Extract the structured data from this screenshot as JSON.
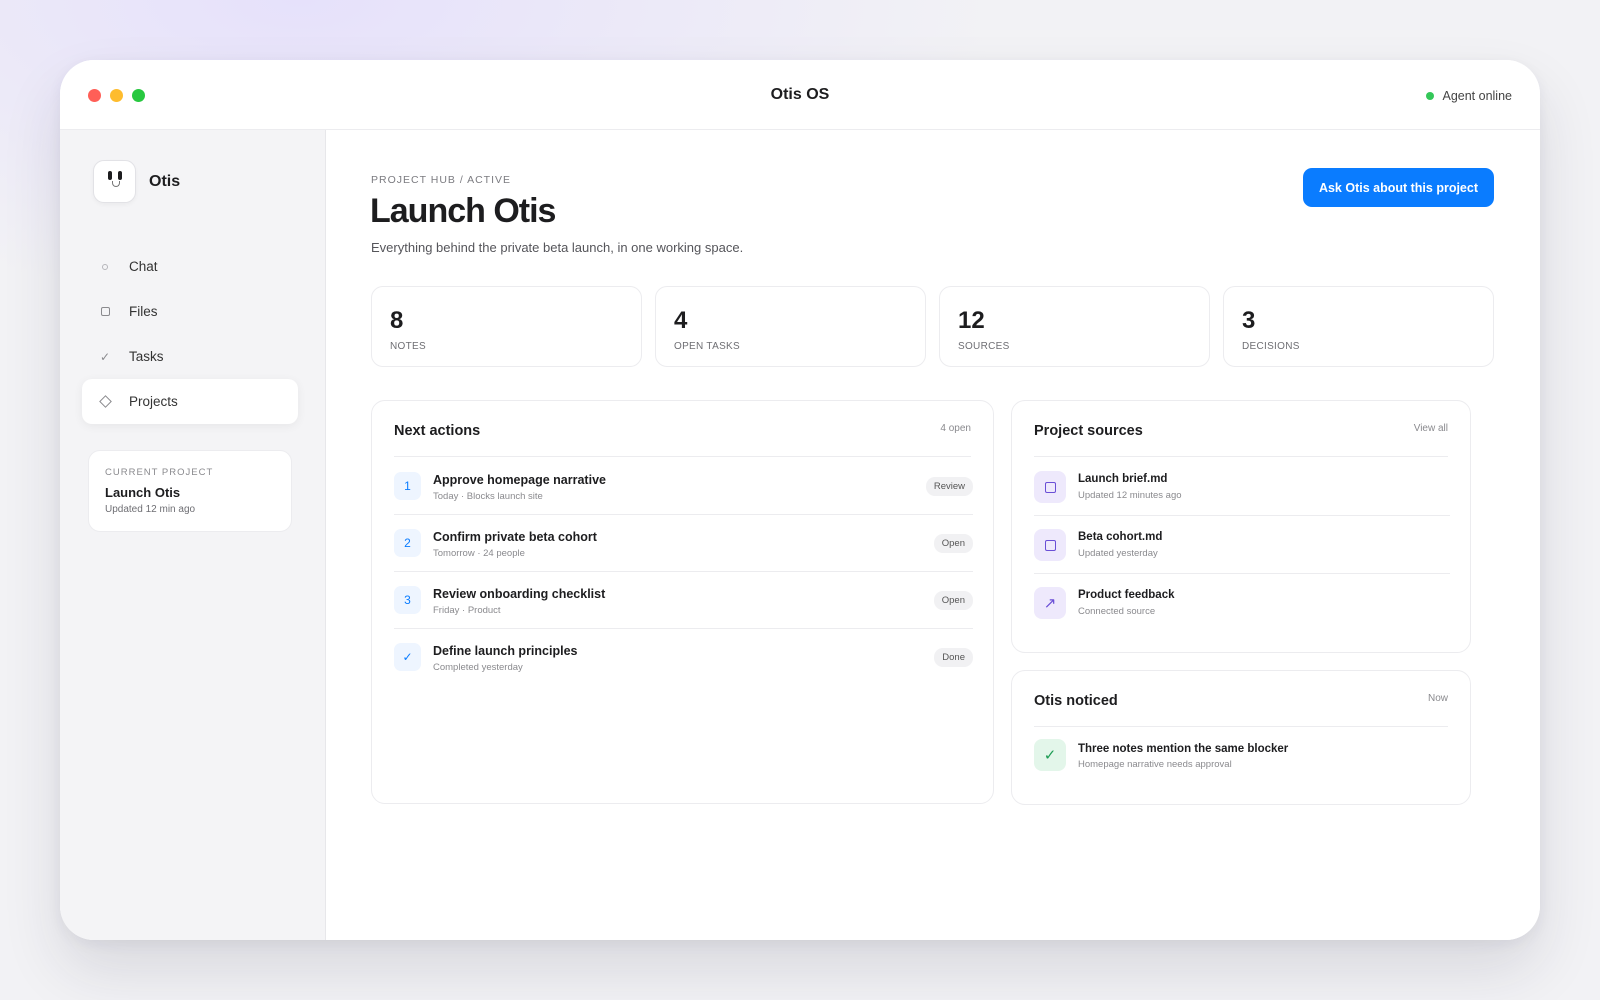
{
  "window": {
    "title": "Otis OS",
    "status": "Agent online"
  },
  "sidebar": {
    "brand": "Otis",
    "items": [
      {
        "label": "Chat",
        "icon": "chat-circle-icon"
      },
      {
        "label": "Files",
        "icon": "file-square-icon"
      },
      {
        "label": "Tasks",
        "icon": "check-icon"
      },
      {
        "label": "Projects",
        "icon": "diamond-icon",
        "active": true
      }
    ],
    "current_project": {
      "label": "Current project",
      "name": "Launch Otis",
      "updated": "Updated 12 min ago"
    }
  },
  "main": {
    "breadcrumb": "Project hub / Active",
    "title": "Launch Otis",
    "subtitle": "Everything behind the private beta launch, in one working space.",
    "ask_button": "Ask Otis about this project",
    "stats": [
      {
        "value": "8",
        "label": "Notes"
      },
      {
        "value": "4",
        "label": "Open tasks"
      },
      {
        "value": "12",
        "label": "Sources"
      },
      {
        "value": "3",
        "label": "Decisions"
      }
    ],
    "next_actions": {
      "title": "Next actions",
      "meta": "4 open",
      "items": [
        {
          "marker": "1",
          "title": "Approve homepage narrative",
          "sub": "Today · Blocks launch site",
          "badge": "Review"
        },
        {
          "marker": "2",
          "title": "Confirm private beta cohort",
          "sub": "Tomorrow · 24 people",
          "badge": "Open"
        },
        {
          "marker": "3",
          "title": "Review onboarding checklist",
          "sub": "Friday · Product",
          "badge": "Open"
        },
        {
          "marker": "✓",
          "title": "Define launch principles",
          "sub": "Completed yesterday",
          "badge": "Done"
        }
      ]
    },
    "sources": {
      "title": "Project sources",
      "meta": "View all",
      "items": [
        {
          "title": "Launch brief.md",
          "sub": "Updated 12 minutes ago",
          "icon": "file-icon"
        },
        {
          "title": "Beta cohort.md",
          "sub": "Updated yesterday",
          "icon": "file-icon"
        },
        {
          "title": "Product feedback",
          "sub": "Connected source",
          "icon": "arrow-up-right-icon"
        }
      ]
    },
    "noticed": {
      "title": "Otis noticed",
      "meta": "Now",
      "item": {
        "title": "Three notes mention the same blocker",
        "sub": "Homepage narrative needs approval",
        "icon": "check-icon"
      }
    }
  },
  "colors": {
    "accent": "#0a7cff",
    "status_online": "#34c759",
    "source_icon": "#6a4fd6",
    "noticed_icon": "#1f9d55"
  }
}
